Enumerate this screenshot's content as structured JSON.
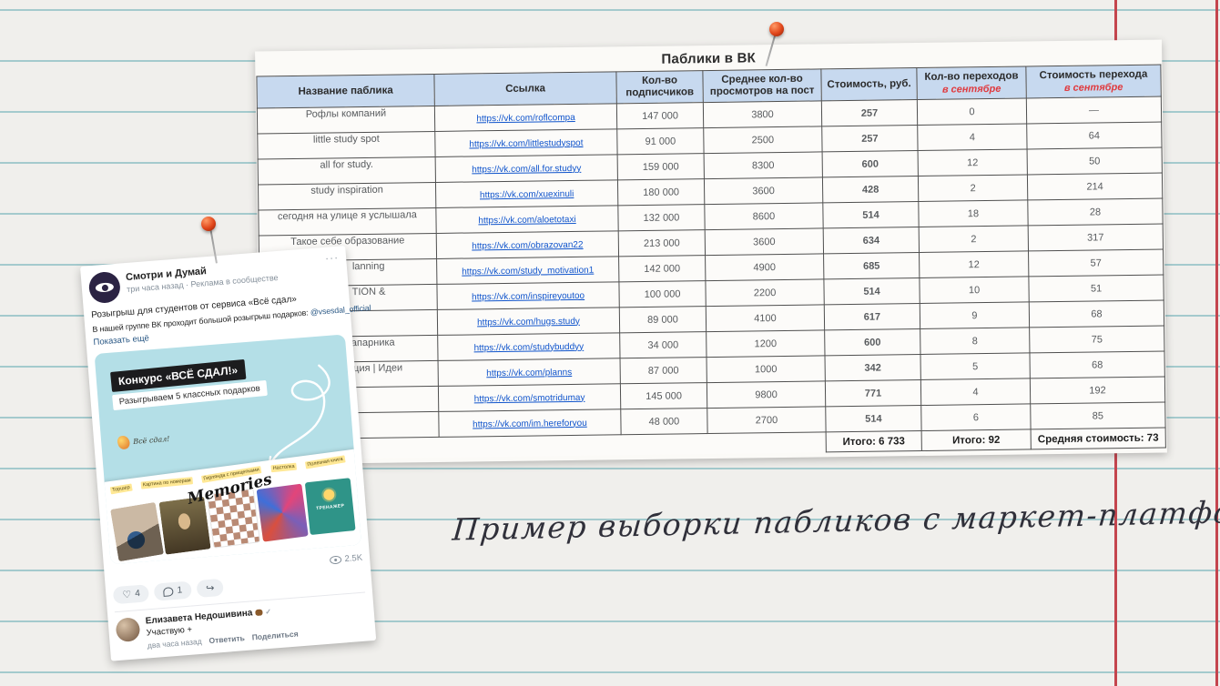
{
  "colors": {
    "paper": "#f0efec",
    "rule_teal": "#a4cacd",
    "margin_red": "#c4454e",
    "header_blue": "#c7d9ef",
    "link_blue": "#1155cc",
    "september_red": "#e03a3e",
    "card_cyan": "#b4dfe7",
    "pin_red": "#e0451a"
  },
  "caption": {
    "text": "Пример выборки пабликов с маркет-платформы"
  },
  "table": {
    "title": "Паблики в ВК",
    "columns": [
      {
        "lines": [
          "Название паблика"
        ]
      },
      {
        "lines": [
          "Ссылка"
        ]
      },
      {
        "lines": [
          "Кол-во",
          "подписчиков"
        ]
      },
      {
        "lines": [
          "Среднее кол-во",
          "просмотров на пост"
        ]
      },
      {
        "lines": [
          "Стоимость, руб."
        ]
      },
      {
        "lines": [
          "Кол-во переходов"
        ],
        "sub": "в сентябре"
      },
      {
        "lines": [
          "Стоимость перехода"
        ],
        "sub": "в сентябре"
      }
    ],
    "rows": [
      {
        "name": "Рофлы компаний",
        "link": "https://vk.com/roflcompa",
        "subs": "147 000",
        "views": "3800",
        "cost": "257",
        "clicks": "0",
        "cpc": "—"
      },
      {
        "name": "little study spot",
        "link": "https://vk.com/littlestudyspot",
        "subs": "91 000",
        "views": "2500",
        "cost": "257",
        "clicks": "4",
        "cpc": "64"
      },
      {
        "name": "all for study.",
        "link": "https://vk.com/all.for.studyy",
        "subs": "159 000",
        "views": "8300",
        "cost": "600",
        "clicks": "12",
        "cpc": "50"
      },
      {
        "name": "study inspiration",
        "link": "https://vk.com/xuexinuli",
        "subs": "180 000",
        "views": "3600",
        "cost": "428",
        "clicks": "2",
        "cpc": "214"
      },
      {
        "name": "сегодня на улице я услышала",
        "link": "https://vk.com/aloetotaxi",
        "subs": "132 000",
        "views": "8600",
        "cost": "514",
        "clicks": "18",
        "cpc": "28"
      },
      {
        "name": "Такое себе образование",
        "link": "https://vk.com/obrazovan22",
        "subs": "213 000",
        "views": "3600",
        "cost": "634",
        "clicks": "2",
        "cpc": "317"
      },
      {
        "name": "lanning",
        "indent": true,
        "link": "https://vk.com/study_motivation1",
        "subs": "142 000",
        "views": "4900",
        "cost": "685",
        "clicks": "12",
        "cpc": "57"
      },
      {
        "name": "TION &",
        "indent": true,
        "link": "https://vk.com/inspireyoutoo",
        "subs": "100 000",
        "views": "2200",
        "cost": "514",
        "clicks": "10",
        "cpc": "51"
      },
      {
        "name": "",
        "link": "https://vk.com/hugs.study",
        "subs": "89 000",
        "views": "4100",
        "cost": "617",
        "clicks": "9",
        "cpc": "68"
      },
      {
        "name": "Напарника",
        "indent": true,
        "link": "https://vk.com/studybuddyy",
        "subs": "34 000",
        "views": "1200",
        "cost": "600",
        "clicks": "8",
        "cpc": "75"
      },
      {
        "name": "ивация | Идеи",
        "indent": true,
        "link": "https://vk.com/planns",
        "subs": "87 000",
        "views": "1000",
        "cost": "342",
        "clicks": "5",
        "cpc": "68"
      },
      {
        "name": "",
        "link": "https://vk.com/smotridumay",
        "subs": "145 000",
        "views": "9800",
        "cost": "771",
        "clicks": "4",
        "cpc": "192"
      },
      {
        "name": "",
        "link": "https://vk.com/im.hereforyou",
        "subs": "48 000",
        "views": "2700",
        "cost": "514",
        "clicks": "6",
        "cpc": "85"
      }
    ],
    "footer": {
      "cost_total": "Итого: 6 733",
      "clicks_total": "Итого: 92",
      "cpc_avg": "Средняя стоимость: 73"
    }
  },
  "post": {
    "community": "Смотри и Думай",
    "meta": "три часа назад · Реклама в сообществе",
    "menu": "···",
    "text1": "Розыгрыш для студентов от сервиса «Всё сдал»",
    "text2": "В нашей группе ВК проходит большой розыгрыш подарков: ",
    "mention": "@vsesdal_official",
    "show_more": "Показать ещё",
    "card": {
      "title": "Конкурс «ВСЁ СДАЛ!»",
      "subtitle": "Разыгрываем 5 классных подарков",
      "mascot_caption": "Всё сдал!",
      "collage_script": "Memories",
      "labels": [
        "Торшер",
        "Картина по номерам",
        "Гирлянда с прищепками",
        "Настолка",
        "Полезная книга"
      ],
      "book_text": "ТРЕНАЖЕР"
    },
    "views": "2.5K",
    "likes": "4",
    "comments_count": "1",
    "comment": {
      "author": "Елизавета Недошивина",
      "text": "Участвую +",
      "time": "два часа назад",
      "reply": "Ответить",
      "share": "Поделиться"
    }
  }
}
